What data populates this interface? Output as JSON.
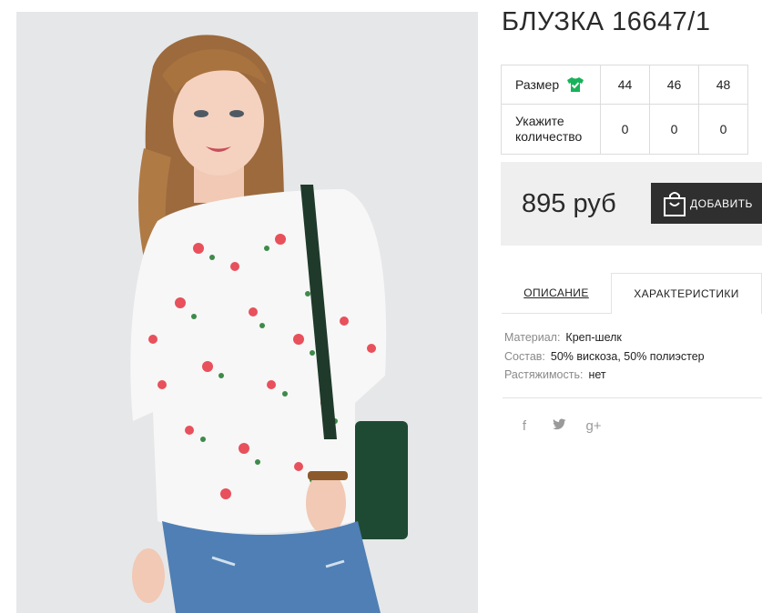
{
  "product": {
    "title": "БЛУЗКА 16647/1",
    "image_alt": "Блузка 16647/1"
  },
  "sizes": {
    "size_label": "Размер",
    "quantity_label_line1": "Укажите",
    "quantity_label_line2": "количество",
    "columns": [
      {
        "size": "44",
        "qty": "0"
      },
      {
        "size": "46",
        "qty": "0"
      },
      {
        "size": "48",
        "qty": "0"
      }
    ]
  },
  "purchase": {
    "price": "895 руб",
    "add_label": "ДОБАВИТЬ"
  },
  "tabs": {
    "description": "ОПИСАНИЕ",
    "characteristics": "ХАРАКТЕРИСТИКИ"
  },
  "specs": [
    {
      "label": "Материал:",
      "value": "Креп-шелк"
    },
    {
      "label": "Состав:",
      "value": "50% вискоза, 50% полиэстер"
    },
    {
      "label": "Растяжимость:",
      "value": "нет"
    }
  ],
  "social": {
    "facebook": "f",
    "twitter": "🐦",
    "googleplus": "g+"
  },
  "colors": {
    "button_bg": "#2f2f2f",
    "price_bg": "#efefef",
    "size_icon": "#17b35a"
  }
}
